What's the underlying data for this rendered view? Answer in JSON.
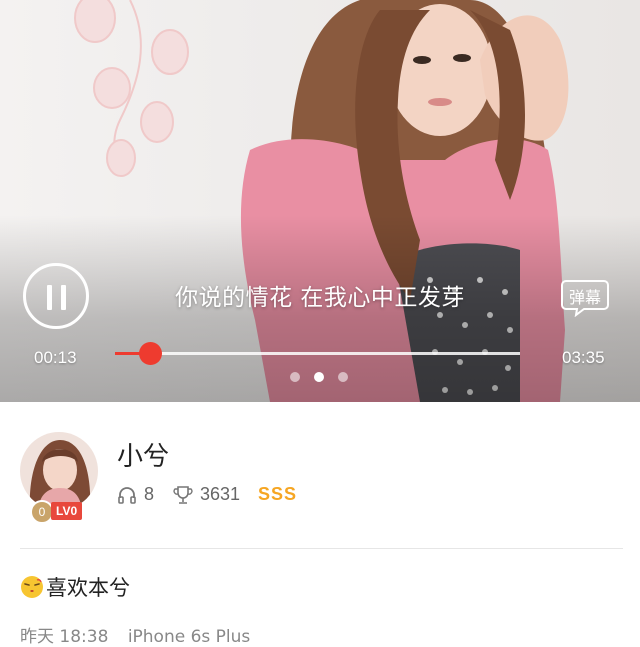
{
  "player": {
    "lyric": "你说的情花 在我心中正发芽",
    "danmu_label": "弹幕",
    "current_time": "00:13",
    "duration": "03:35",
    "progress": 0.086,
    "pages": 3,
    "active_page": 1,
    "accent_color": "#ee3b2f",
    "play_state_icon": "pause-icon"
  },
  "profile": {
    "username": "小兮",
    "level_coin": "0",
    "level_badge": "LV0",
    "listen_count": "8",
    "trophy_count": "3631",
    "rank": "SSS",
    "rank_color": "#f6a623",
    "status_emoji": "kiss-face-icon",
    "status_text": "喜欢本兮",
    "time": "昨天 18:38",
    "device": "iPhone 6s Plus"
  }
}
